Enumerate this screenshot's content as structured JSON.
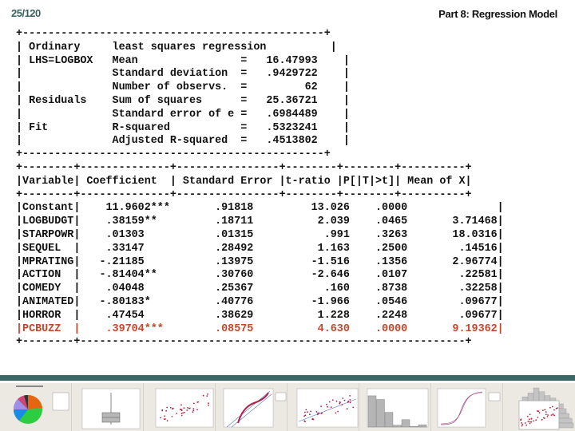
{
  "header": {
    "page_number": "25/120",
    "title": "Part 8: Regression Model"
  },
  "summary": {
    "border": "+-----------------------------------------------+",
    "rows": [
      {
        "section": "Ordinary",
        "label": "least squares regression",
        "value": ""
      },
      {
        "section": "LHS=LOGBOX",
        "label": "Mean",
        "value": "16.47993"
      },
      {
        "section": "",
        "label": "Standard deviation",
        "value": ".9429722"
      },
      {
        "section": "",
        "label": "Number of observs.",
        "value": "62"
      },
      {
        "section": "Residuals",
        "label": "Sum of squares",
        "value": "25.36721"
      },
      {
        "section": "",
        "label": "Standard error of e",
        "value": ".6984489"
      },
      {
        "section": "Fit",
        "label": "R-squared",
        "value": ".5323241"
      },
      {
        "section": "",
        "label": "Adjusted R-squared",
        "value": ".4513802"
      }
    ]
  },
  "coefficients": {
    "border_top": "+--------+--------------+----------------+--------+--------+----------+",
    "border_bottom": "+--------+------------------------------------------------------------+",
    "headers": [
      "Variable",
      "Coefficient",
      "Standard Error",
      "t-ratio",
      "P[|T|>t]",
      "Mean of X"
    ],
    "rows": [
      {
        "variable": "Constant",
        "coefficient": "11.9602***",
        "std_error": ".91818",
        "t_ratio": "13.026",
        "p_value": ".0000",
        "mean_x": "",
        "highlight": false
      },
      {
        "variable": "LOGBUDGT",
        "coefficient": ".38159**",
        "std_error": ".18711",
        "t_ratio": "2.039",
        "p_value": ".0465",
        "mean_x": "3.71468",
        "highlight": false
      },
      {
        "variable": "STARPOWR",
        "coefficient": ".01303",
        "std_error": ".01315",
        "t_ratio": ".991",
        "p_value": ".3263",
        "mean_x": "18.0316",
        "highlight": false
      },
      {
        "variable": "SEQUEL",
        "coefficient": ".33147",
        "std_error": ".28492",
        "t_ratio": "1.163",
        "p_value": ".2500",
        "mean_x": ".14516",
        "highlight": false
      },
      {
        "variable": "MPRATING",
        "coefficient": "-.21185",
        "std_error": ".13975",
        "t_ratio": "-1.516",
        "p_value": ".1356",
        "mean_x": "2.96774",
        "highlight": false
      },
      {
        "variable": "ACTION",
        "coefficient": "-.81404**",
        "std_error": ".30760",
        "t_ratio": "-2.646",
        "p_value": ".0107",
        "mean_x": ".22581",
        "highlight": false
      },
      {
        "variable": "COMEDY",
        "coefficient": ".04048",
        "std_error": ".25367",
        "t_ratio": ".160",
        "p_value": ".8738",
        "mean_x": ".32258",
        "highlight": false
      },
      {
        "variable": "ANIMATED",
        "coefficient": "-.80183*",
        "std_error": ".40776",
        "t_ratio": "-1.966",
        "p_value": ".0546",
        "mean_x": ".09677",
        "highlight": false
      },
      {
        "variable": "HORROR",
        "coefficient": ".47454",
        "std_error": ".38629",
        "t_ratio": "1.228",
        "p_value": ".2248",
        "mean_x": ".09677",
        "highlight": false
      },
      {
        "variable": "PCBUZZ",
        "coefficient": ".39704***",
        "std_error": ".08575",
        "t_ratio": "4.630",
        "p_value": ".0000",
        "mean_x": "9.19362",
        "highlight": true
      }
    ]
  },
  "thumbnails": [
    {
      "name": "pie-chart-thumbnail",
      "caption": "Pie Chart of Movies by Type"
    },
    {
      "name": "boxplot-thumbnail",
      "caption": "Boxplot of Box Office"
    },
    {
      "name": "scatterplot-thumbnail-1",
      "caption": "Scatterplot"
    },
    {
      "name": "probability-plot-thumbnail",
      "caption": "Probability Plot"
    },
    {
      "name": "scatterplot-thumbnail-2",
      "caption": "Scatterplot with regression line"
    },
    {
      "name": "histogram-thumbnail",
      "caption": "Histogram"
    },
    {
      "name": "cdf-plot-thumbnail",
      "caption": "Empirical CDF"
    },
    {
      "name": "marginal-plot-thumbnail",
      "caption": "Marginal Plot"
    }
  ],
  "colors": {
    "highlight": "#c8452a",
    "band": "#3a6666",
    "page_number": "#3c6060"
  }
}
